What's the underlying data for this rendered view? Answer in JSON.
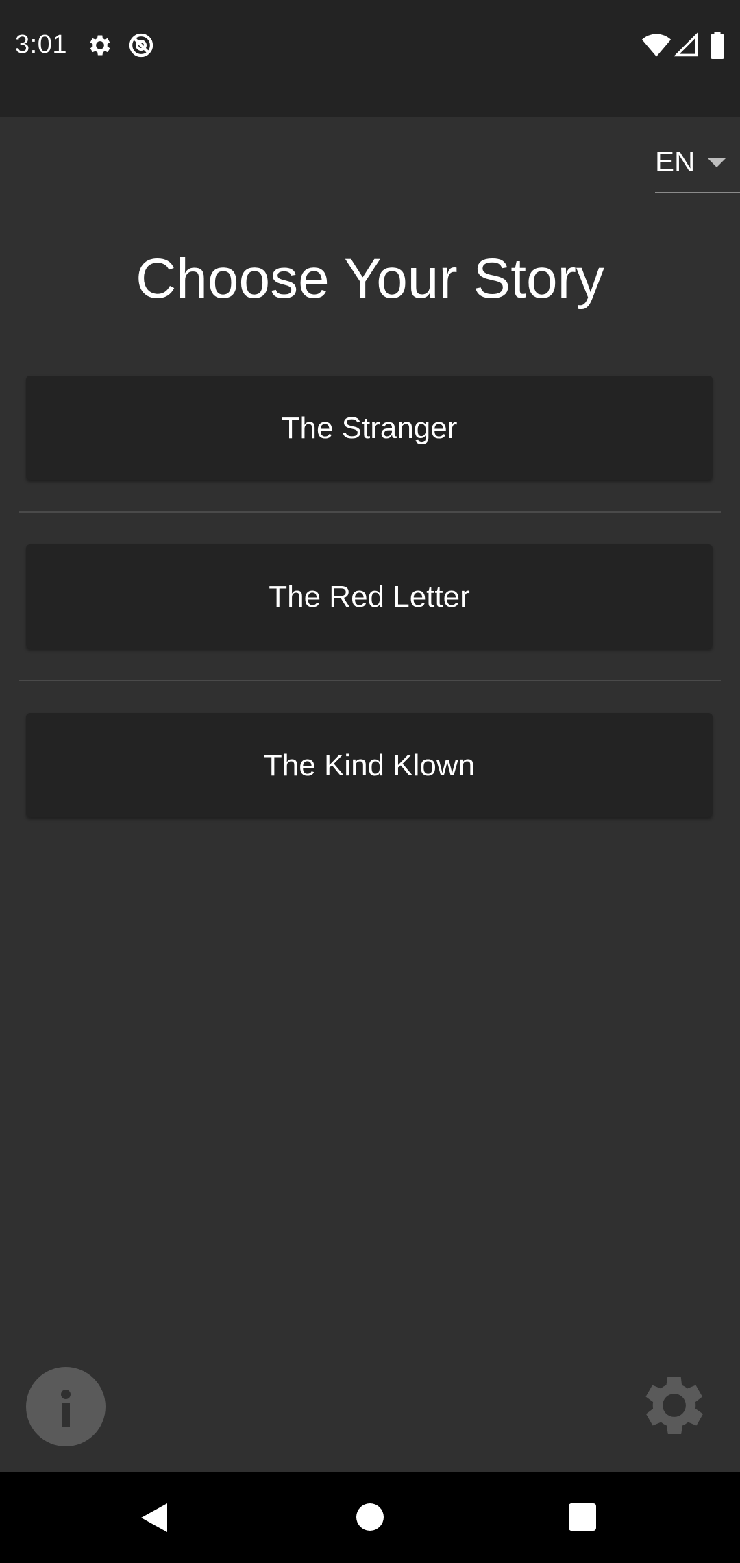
{
  "status_bar": {
    "time": "3:01",
    "icons": [
      "gear-icon",
      "no-sync-icon",
      "wifi-icon",
      "signal-icon",
      "battery-icon"
    ]
  },
  "language_selector": {
    "value": "EN"
  },
  "title": "Choose Your Story",
  "stories": [
    {
      "label": "The Stranger"
    },
    {
      "label": "The Red Letter"
    },
    {
      "label": "The Kind Klown"
    }
  ],
  "bottom_actions": {
    "info_icon": "info-icon",
    "settings_icon": "settings-gear-icon"
  },
  "nav_bar": {
    "buttons": [
      "back-icon",
      "home-icon",
      "recents-icon"
    ]
  },
  "colors": {
    "background": "#303030",
    "status_bar": "#232323",
    "button": "#232323",
    "divider": "#4a4a4a",
    "icon_gray": "#5a5a5a"
  }
}
